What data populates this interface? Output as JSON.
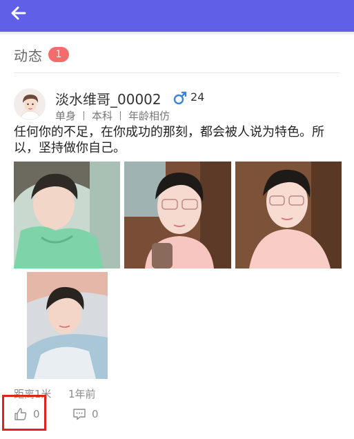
{
  "header": {
    "back_icon": "arrow-left-icon",
    "bar_color": "#5f5fe8"
  },
  "section": {
    "title": "动态",
    "count": "1",
    "badge_color": "#f46c6c"
  },
  "post": {
    "username": "淡水维哥_00002",
    "gender_icon": "male-icon",
    "age": "24",
    "tags": [
      "单身",
      "本科",
      "年龄相仿"
    ],
    "text": "任何你的不足，在你成功的那刻，都会被人说为特色。所以，坚持做你自己。",
    "photos": [
      {
        "name": "post-photo-1"
      },
      {
        "name": "post-photo-2"
      },
      {
        "name": "post-photo-3"
      },
      {
        "name": "post-photo-4"
      }
    ],
    "distance": "距离1米",
    "time": "1年前",
    "likes": "0",
    "comments": "0",
    "like_icon": "thumbs-up-icon",
    "comment_icon": "comment-icon"
  },
  "highlight_color": "#e0221c"
}
